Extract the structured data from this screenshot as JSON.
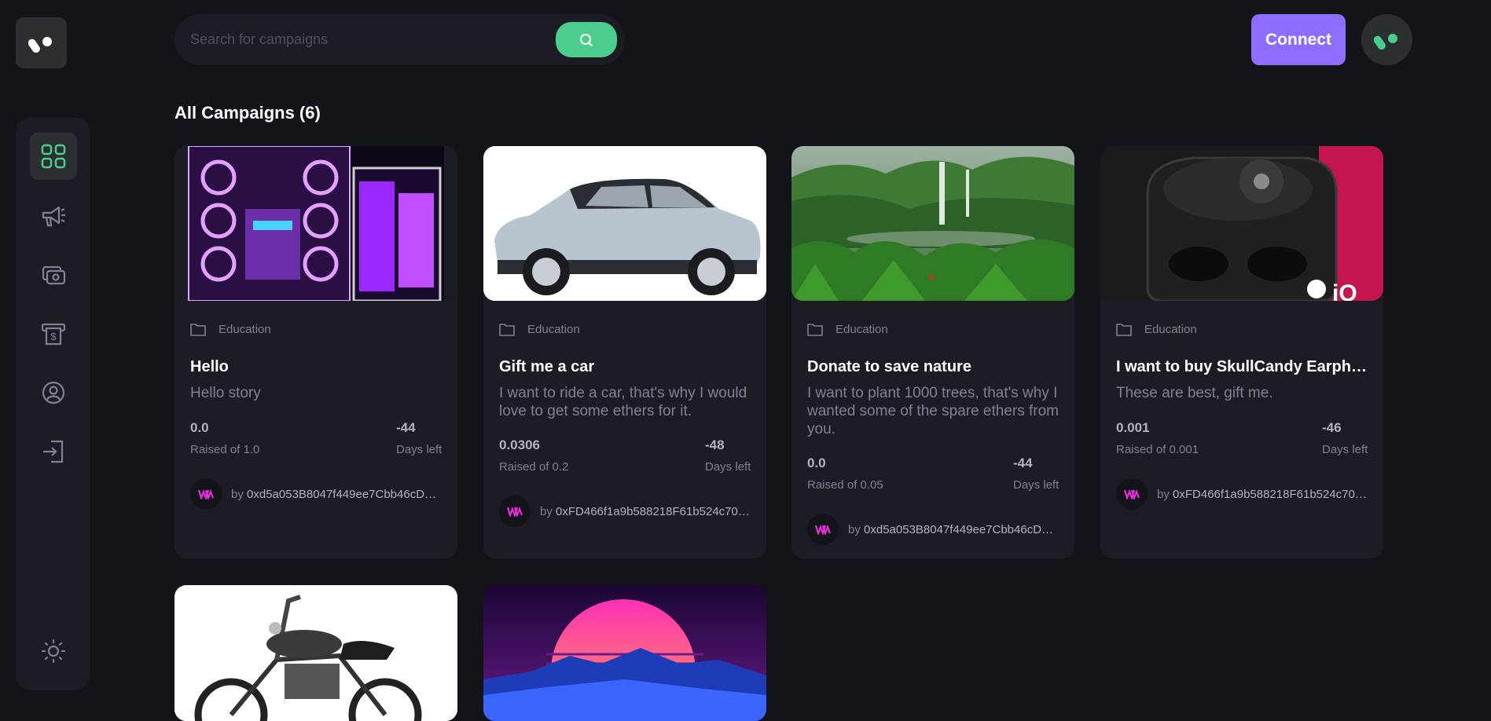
{
  "header": {
    "search_placeholder": "Search for campaigns",
    "connect_label": "Connect"
  },
  "sidebar": {
    "items": [
      {
        "icon": "dashboard-icon",
        "active": true
      },
      {
        "icon": "campaign-icon",
        "active": false
      },
      {
        "icon": "payment-icon",
        "active": false
      },
      {
        "icon": "withdraw-icon",
        "active": false
      },
      {
        "icon": "profile-icon",
        "active": false
      },
      {
        "icon": "logout-icon",
        "active": false
      },
      {
        "icon": "sun-icon",
        "active": false
      }
    ]
  },
  "main": {
    "title": "All Campaigns (6)",
    "campaigns": [
      {
        "category": "Education",
        "title": "Hello",
        "description": "Hello story",
        "raised": "0.0",
        "raised_label": "Raised of 1.0",
        "days": "-44",
        "days_label": "Days left",
        "by": "by",
        "owner": "0xd5a053B8047f449ee7Cbb46cD…"
      },
      {
        "category": "Education",
        "title": "Gift me a car",
        "description": "I want to ride a car, that's why I would love to get some ethers for it.",
        "raised": "0.0306",
        "raised_label": "Raised of 0.2",
        "days": "-48",
        "days_label": "Days left",
        "by": "by",
        "owner": "0xFD466f1a9b588218F61b524c70…"
      },
      {
        "category": "Education",
        "title": "Donate to save nature",
        "description": "I want to plant 1000 trees, that's why I wanted some of the spare ethers from you.",
        "raised": "0.0",
        "raised_label": "Raised of 0.05",
        "days": "-44",
        "days_label": "Days left",
        "by": "by",
        "owner": "0xd5a053B8047f449ee7Cbb46cD…"
      },
      {
        "category": "Education",
        "title": "I want to buy SkullCandy Earphones",
        "description": "These are best, gift me.",
        "raised": "0.001",
        "raised_label": "Raised of 0.001",
        "days": "-46",
        "days_label": "Days left",
        "by": "by",
        "owner": "0xFD466f1a9b588218F61b524c70…"
      }
    ]
  },
  "colors": {
    "background": "#13131a",
    "surface": "#1c1c24",
    "accent_green": "#4acd8d",
    "accent_purple": "#8c6dfd",
    "text_muted": "#808191"
  }
}
